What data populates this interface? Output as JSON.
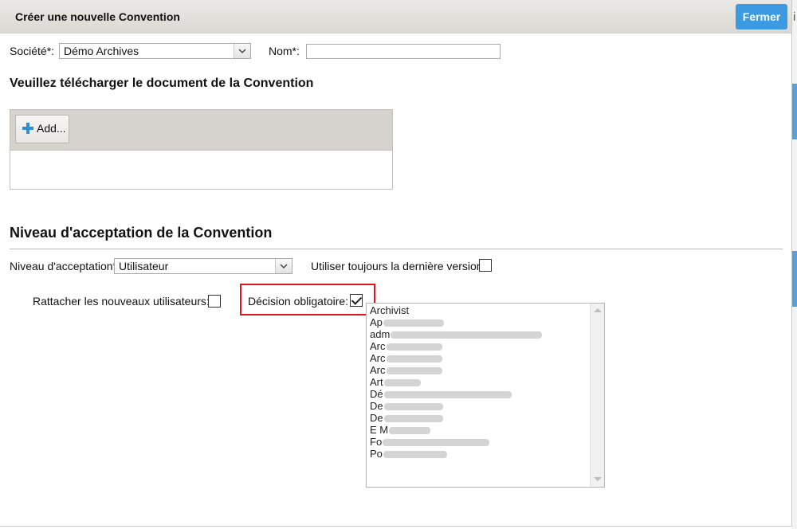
{
  "dialog": {
    "title": "Créer une nouvelle Convention",
    "close_label": "Fermer"
  },
  "form": {
    "societe_label": "Société*:",
    "societe_value": "Démo Archives",
    "nom_label": "Nom*:",
    "nom_value": ""
  },
  "upload": {
    "heading": "Veuillez télécharger le document de la Convention",
    "add_label": "Add..."
  },
  "acceptance": {
    "heading": "Niveau d'acceptation de la Convention",
    "niveau_label": "Niveau d'acceptation*:",
    "niveau_value": "Utilisateur",
    "derniere_version_label": "Utiliser toujours la dernière version:",
    "derniere_version_checked": false,
    "rattacher_label": "Rattacher les nouveaux utilisateurs:",
    "rattacher_checked": false,
    "decision_label": "Décision obligatoire:",
    "decision_checked": true
  },
  "user_list": {
    "items": [
      "Archivist",
      "Ap",
      "adm",
      "Arc",
      "Arc",
      "Arc",
      "Art",
      "Dé",
      "De",
      "De",
      "E M",
      "Fo",
      "Po"
    ]
  },
  "right_edge": {
    "glyph": "i"
  },
  "colors": {
    "accent": "#3b9ae1",
    "highlight": "#e0141c"
  }
}
